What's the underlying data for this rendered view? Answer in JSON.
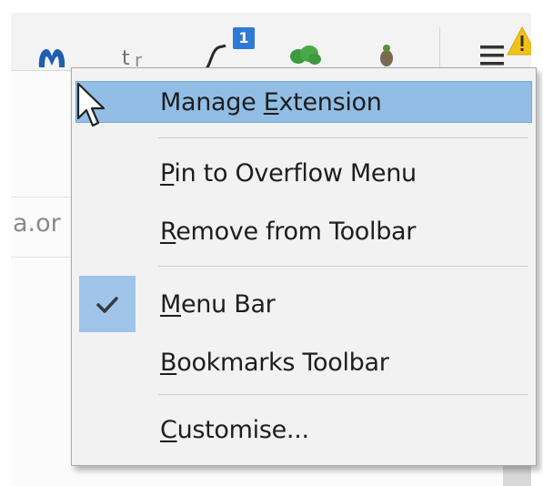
{
  "toolbar": {
    "icons": [
      {
        "name": "malwarebytes-extension-icon",
        "color": "#1f5fb0"
      },
      {
        "name": "translate-extension-icon",
        "color": "#7a7a7a"
      },
      {
        "name": "graph-extension-icon",
        "color": "#2a2a2a"
      },
      {
        "name": "badge-notification-icon",
        "color": "#2e7ad6",
        "badge_text": "1"
      },
      {
        "name": "leaf-extension-icon",
        "color": "#3d9a3d"
      },
      {
        "name": "bug-extension-icon",
        "color": "#7a6a52"
      },
      {
        "name": "hamburger-menu-icon",
        "color": "#333333"
      },
      {
        "name": "warning-icon",
        "color": "#f2c218"
      }
    ]
  },
  "page": {
    "url_fragment": "a.or"
  },
  "menu": {
    "items": [
      {
        "pre": "Manage ",
        "acc": "E",
        "post": "xtension",
        "highlighted": true,
        "checked": false
      },
      {
        "pre": "",
        "acc": "P",
        "post": "in to Overflow Menu",
        "highlighted": false,
        "checked": false
      },
      {
        "pre": "",
        "acc": "R",
        "post": "emove from Toolbar",
        "highlighted": false,
        "checked": false
      },
      {
        "pre": "",
        "acc": "M",
        "post": "enu Bar",
        "highlighted": false,
        "checked": true
      },
      {
        "pre": "",
        "acc": "B",
        "post": "ookmarks Toolbar",
        "highlighted": false,
        "checked": false
      },
      {
        "pre": "",
        "acc": "C",
        "post": "ustomise...",
        "highlighted": false,
        "checked": false
      }
    ]
  },
  "colors": {
    "highlight": "#92bee6",
    "check_box": "#9ec5e9",
    "menu_bg": "#f2f2f2"
  }
}
